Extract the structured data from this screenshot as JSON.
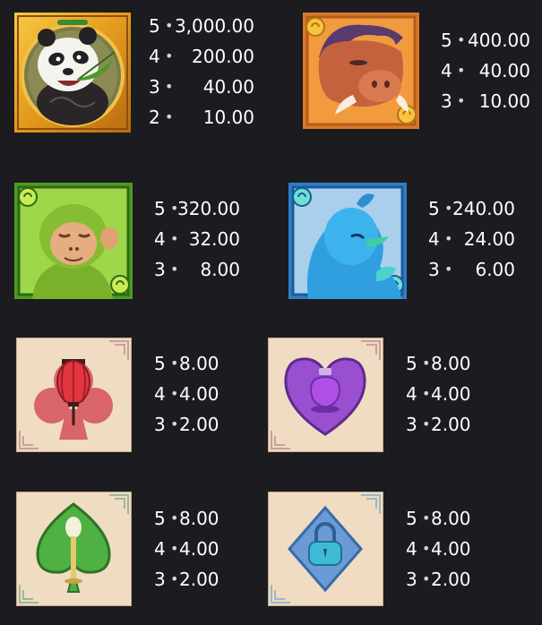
{
  "bullet": "•",
  "symbols": [
    {
      "name": "panda",
      "pays": [
        {
          "count": "5",
          "value": "3,000.00"
        },
        {
          "count": "4",
          "value": "200.00"
        },
        {
          "count": "3",
          "value": "40.00"
        },
        {
          "count": "2",
          "value": "10.00"
        }
      ]
    },
    {
      "name": "boar",
      "pays": [
        {
          "count": "5",
          "value": "400.00"
        },
        {
          "count": "4",
          "value": "40.00"
        },
        {
          "count": "3",
          "value": "10.00"
        }
      ]
    },
    {
      "name": "monkey",
      "pays": [
        {
          "count": "5",
          "value": "320.00"
        },
        {
          "count": "4",
          "value": "32.00"
        },
        {
          "count": "3",
          "value": "8.00"
        }
      ]
    },
    {
      "name": "bird",
      "pays": [
        {
          "count": "5",
          "value": "240.00"
        },
        {
          "count": "4",
          "value": "24.00"
        },
        {
          "count": "3",
          "value": "6.00"
        }
      ]
    },
    {
      "name": "lantern-club",
      "pays": [
        {
          "count": "5",
          "value": "8.00"
        },
        {
          "count": "4",
          "value": "4.00"
        },
        {
          "count": "3",
          "value": "2.00"
        }
      ]
    },
    {
      "name": "potion-heart",
      "pays": [
        {
          "count": "5",
          "value": "8.00"
        },
        {
          "count": "4",
          "value": "4.00"
        },
        {
          "count": "3",
          "value": "2.00"
        }
      ]
    },
    {
      "name": "lotus-spade",
      "pays": [
        {
          "count": "5",
          "value": "8.00"
        },
        {
          "count": "4",
          "value": "4.00"
        },
        {
          "count": "3",
          "value": "2.00"
        }
      ]
    },
    {
      "name": "lock-diamond",
      "pays": [
        {
          "count": "5",
          "value": "8.00"
        },
        {
          "count": "4",
          "value": "4.00"
        },
        {
          "count": "3",
          "value": "2.00"
        }
      ]
    }
  ],
  "colors": {
    "background": "#1c1b20",
    "text": "#ffffff",
    "bullet": "#d6d6d6"
  }
}
